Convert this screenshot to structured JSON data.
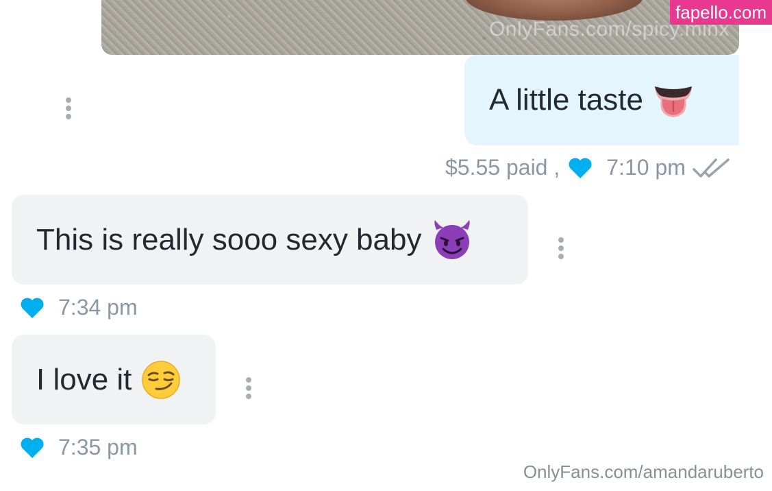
{
  "media": {
    "watermark": "OnlyFans.com/spicy.minx"
  },
  "site_badge": "fapello.com",
  "messages": [
    {
      "direction": "sent",
      "text": "A little taste",
      "emoji": "tongue-emoji",
      "price_text": "$5.55 paid ,",
      "time": "7:10 pm",
      "status_icon": "double-check-icon"
    },
    {
      "direction": "received",
      "text": "This is really sooo sexy baby",
      "emoji": "smiling-devil-emoji",
      "time": "7:34 pm"
    },
    {
      "direction": "received",
      "text": "I love it",
      "emoji": "smirking-face-emoji",
      "time": "7:35 pm"
    }
  ],
  "footer_watermark": "OnlyFans.com/amandaruberto",
  "colors": {
    "accent_blue": "#00aff0",
    "sent_bubble": "#e4f5fe",
    "received_bubble": "#f0f2f4",
    "meta_text": "#8a96a3",
    "badge": "#e8388f"
  }
}
